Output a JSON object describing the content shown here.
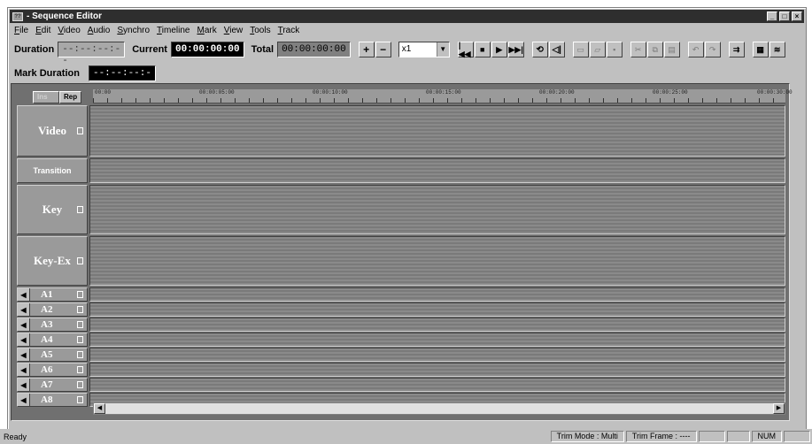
{
  "window": {
    "title": "- Sequence Editor",
    "icon": "app-icon",
    "icon_text": "??"
  },
  "menu": [
    "File",
    "Edit",
    "Video",
    "Audio",
    "Synchro",
    "Timeline",
    "Mark",
    "View",
    "Tools",
    "Track"
  ],
  "toolbar": {
    "duration_label": "Duration",
    "duration_value": "--:--:--:--",
    "current_label": "Current",
    "current_value": "00:00:00:00",
    "total_label": "Total",
    "total_value": "00:00:00:00",
    "plus": "+",
    "minus": "−",
    "speed_value": "x1",
    "transport": [
      "|◀◀",
      "■",
      "▶",
      "▶▶|"
    ],
    "mark_duration_label": "Mark Duration",
    "mark_duration_value": "--:--:--:--"
  },
  "timeline": {
    "tabs": [
      "Ins",
      "Rep"
    ],
    "ruler_labels": [
      "00:00",
      "00:00:05:00",
      "00:00:10:00",
      "00:00:15:00",
      "00:00:20:00",
      "00:00:25:00",
      "00:00:30:00"
    ],
    "video_tracks": [
      "Video",
      "Transition",
      "Key",
      "Key-Ex"
    ],
    "audio_tracks": [
      "A1",
      "A2",
      "A3",
      "A4",
      "A5",
      "A6",
      "A7",
      "A8"
    ]
  },
  "status": {
    "ready": "Ready",
    "trim_mode": "Trim Mode : Multi",
    "trim_frame": "Trim Frame : ----",
    "num": "NUM"
  }
}
